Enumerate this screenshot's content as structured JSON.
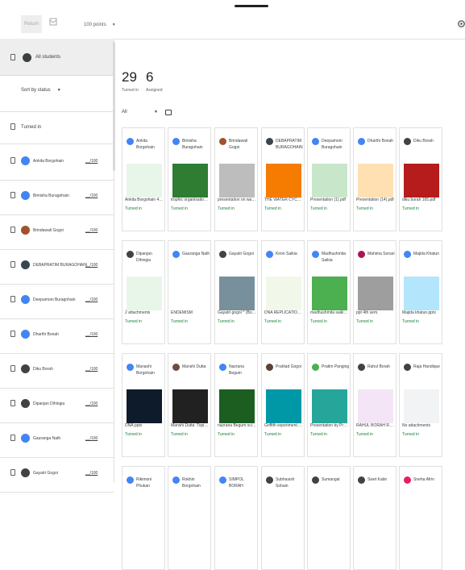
{
  "toolbar": {
    "return_label": "Return",
    "points": "100 points"
  },
  "left": {
    "all_students": "All students",
    "sort": "Sort by status",
    "turned_in_header": "Turned in",
    "students": [
      {
        "name": "Ankita Borgohain",
        "score": "__/100",
        "color": "#4285f4"
      },
      {
        "name": "Bimisha Buragohain",
        "score": "__/100",
        "color": "#4285f4"
      },
      {
        "name": "Brindawali Gogoi",
        "score": "__/100",
        "color": "#a0522d"
      },
      {
        "name": "DEBAPRATIM BURAGOHAIN",
        "score": "__/100",
        "color": "#37474f"
      },
      {
        "name": "Deepamoni Buragohain",
        "score": "__/100",
        "color": "#4285f4"
      },
      {
        "name": "Dharthi Bonah",
        "score": "__/100",
        "color": "#4285f4"
      },
      {
        "name": "Diku Borah",
        "score": "__/100",
        "color": "#424242"
      },
      {
        "name": "Dipanjan Dihingia",
        "score": "__/100",
        "color": "#424242"
      },
      {
        "name": "Gauranga Nath",
        "score": "__/100",
        "color": "#4285f4"
      },
      {
        "name": "Gayatri Gogoi",
        "score": "__/100",
        "color": "#424242"
      }
    ]
  },
  "summary": {
    "turned_in_count": "29",
    "turned_in_label": "Turned in",
    "assigned_count": "6",
    "assigned_label": "Assigned",
    "filter": "All"
  },
  "cards": [
    {
      "name": "Ankita Borgohain",
      "file": "Ankita Borgohain 4th ...",
      "status": "Turned in",
      "av": "#4285f4",
      "thumb": "#e8f5e9"
    },
    {
      "name": "Bimisha Buragohain",
      "file": "trophic organisation P...",
      "status": "Turned in",
      "av": "#4285f4",
      "thumb": "#2e7d32"
    },
    {
      "name": "Brindawali Gogoi",
      "file": "presentation on water ...",
      "status": "Turned in",
      "av": "#a0522d",
      "thumb": "#bdbdbd"
    },
    {
      "name": "DEBAPRATIM BURAGOHAIN",
      "file": "THE WATER CYCLE.p...",
      "status": "Turned in",
      "av": "#37474f",
      "thumb": "#f57c00"
    },
    {
      "name": "Deepamoni Buragohain",
      "file": "Presentation (1).pdf",
      "status": "Turned in",
      "av": "#4285f4",
      "thumb": "#c8e6c9"
    },
    {
      "name": "Dharthi Bonah",
      "file": "Presentation (14).pdf",
      "status": "Turned in",
      "av": "#4285f4",
      "thumb": "#ffe0b2"
    },
    {
      "name": "Diku Borah",
      "file": "diku borah 165.pdf",
      "status": "Turned in",
      "av": "#424242",
      "thumb": "#b71c1c"
    },
    {
      "name": "Dipanjan Dihingia",
      "file": "2 attachments",
      "status": "Turned in",
      "av": "#424242",
      "thumb": "#e8f5e9"
    },
    {
      "name": "Gauranga Nath",
      "file": "ENDEMISM",
      "status": "Turned in",
      "av": "#4285f4",
      "thumb": "#ffffff"
    },
    {
      "name": "Gayatri Gogoi",
      "file": "Gayatri gogoi ^ (Bol p...",
      "status": "Turned in",
      "av": "#424242",
      "thumb": "#78909c"
    },
    {
      "name": "Kiron Saikia",
      "file": "DNA REPLICATION SE...",
      "status": "Turned in",
      "av": "#4285f4",
      "thumb": "#f1f8e9"
    },
    {
      "name": "Madhushmita Saikia",
      "file": "madhushmita saikia.p...",
      "status": "Turned in",
      "av": "#4285f4",
      "thumb": "#4caf50"
    },
    {
      "name": "Mahima Sonari",
      "file": "ppt 4th sem.",
      "status": "Turned in",
      "av": "#ad1457",
      "thumb": "#9e9e9e"
    },
    {
      "name": "Majida Khatun",
      "file": "Majida khatun.pptx",
      "status": "Turned in",
      "av": "#4285f4",
      "thumb": "#b3e5fc"
    },
    {
      "name": "Manashi Borgohain",
      "file": "DNA.pptx",
      "status": "Turned in",
      "av": "#4285f4",
      "thumb": "#0d1b2a"
    },
    {
      "name": "Manshi Dutta",
      "file": "Manshi Dutta :Topic-S...",
      "status": "Turned in",
      "av": "#6d4c41",
      "thumb": "#212121"
    },
    {
      "name": "Nazrana Begum",
      "file": "nazrana Begum sci.p...",
      "status": "Turned in",
      "av": "#4285f4",
      "thumb": "#1b5e20"
    },
    {
      "name": "Prahlad Gogoi",
      "file": "Griffith experiment.pptx",
      "status": "Turned in",
      "av": "#5d4037",
      "thumb": "#0097a7"
    },
    {
      "name": "Pratim Panging",
      "file": "Presentation by Prati...",
      "status": "Turned in",
      "av": "#4caf50",
      "thumb": "#26a69a"
    },
    {
      "name": "Rahul Borah",
      "file": "RAHUL BORAH ROL...",
      "status": "Turned in",
      "av": "#424242",
      "thumb": "#f3e5f5"
    },
    {
      "name": "Raja Handique",
      "file": "No attachments",
      "status": "Turned in",
      "av": "#424242",
      "thumb": ""
    },
    {
      "name": "Rikimoni Phukan",
      "file": "",
      "status": "",
      "av": "#4285f4",
      "thumb": ""
    },
    {
      "name": "Rokhin Borgohain",
      "file": "",
      "status": "",
      "av": "#4285f4",
      "thumb": ""
    },
    {
      "name": "SIMPOL BORAH",
      "file": "",
      "status": "",
      "av": "#4285f4",
      "thumb": ""
    },
    {
      "name": "Subhasish Sohain",
      "file": "",
      "status": "",
      "av": "#424242",
      "thumb": ""
    },
    {
      "name": "Sumangal",
      "file": "",
      "status": "",
      "av": "#424242",
      "thumb": ""
    },
    {
      "name": "Swet Kabir",
      "file": "",
      "status": "",
      "av": "#424242",
      "thumb": ""
    },
    {
      "name": "Sneha Afrin",
      "file": "",
      "status": "",
      "av": "#e91e63",
      "thumb": ""
    }
  ]
}
